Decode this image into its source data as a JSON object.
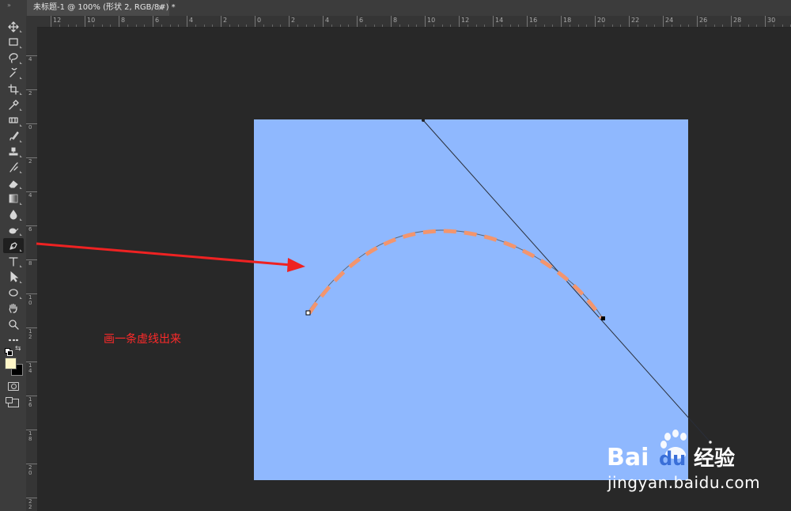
{
  "document_tab": {
    "title": "未标题-1 @ 100% (形状 2, RGB/8#) *",
    "close_glyph": "×"
  },
  "rulers": {
    "horizontal": [
      "12",
      "10",
      "8",
      "6",
      "4",
      "2",
      "0",
      "2",
      "4",
      "6",
      "8",
      "10",
      "12",
      "14",
      "16",
      "18",
      "20",
      "22",
      "24",
      "26",
      "28",
      "30"
    ],
    "vertical": [
      "4",
      "2",
      "0",
      "2",
      "4",
      "6",
      "8",
      "10",
      "12",
      "14",
      "16",
      "18",
      "20",
      "22"
    ]
  },
  "toolbar": {
    "tools": [
      {
        "name": "move-icon",
        "active": false
      },
      {
        "name": "rect-marquee-icon",
        "active": false
      },
      {
        "name": "lasso-icon",
        "active": false
      },
      {
        "name": "quick-select-icon",
        "active": false
      },
      {
        "name": "crop-icon",
        "active": false
      },
      {
        "name": "eyedropper-icon",
        "active": false
      },
      {
        "name": "spot-heal-icon",
        "active": false
      },
      {
        "name": "brush-icon",
        "active": false
      },
      {
        "name": "stamp-icon",
        "active": false
      },
      {
        "name": "history-brush-icon",
        "active": false
      },
      {
        "name": "eraser-icon",
        "active": false
      },
      {
        "name": "gradient-icon",
        "active": false
      },
      {
        "name": "blur-icon",
        "active": false
      },
      {
        "name": "dodge-icon",
        "active": false
      },
      {
        "name": "pen-icon",
        "active": true
      },
      {
        "name": "type-icon",
        "active": false
      },
      {
        "name": "path-select-icon",
        "active": false
      },
      {
        "name": "ellipse-icon",
        "active": false
      },
      {
        "name": "hand-icon",
        "active": false
      },
      {
        "name": "zoom-icon",
        "active": false
      },
      {
        "name": "more-icon",
        "active": false
      }
    ],
    "foreground_color": "#fff6c8",
    "background_color": "#000000"
  },
  "document": {
    "background_color": "#8fb8fe"
  },
  "annotation": {
    "text": "画一条虚线出来",
    "color": "#ff2a2a"
  },
  "watermark": {
    "url_text": "jingyan.baidu.com",
    "logo_text_bai": "Bai",
    "logo_text_du": "du",
    "logo_text_cn": "经验"
  },
  "stroke": {
    "dash_color": "#f2956e"
  }
}
